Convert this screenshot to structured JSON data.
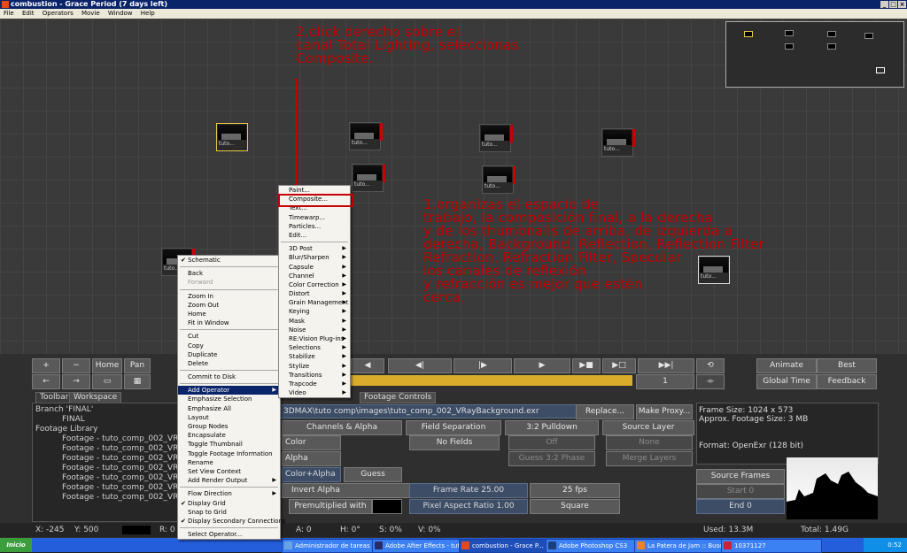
{
  "window": {
    "title": "combustion - Grace Period (7 days left)"
  },
  "menubar": [
    "File",
    "Edit",
    "Operators",
    "Movie",
    "Window",
    "Help"
  ],
  "schematic": {
    "nodes": [
      {
        "label": "tuto..."
      },
      {
        "label": "tuto..."
      },
      {
        "label": "tuto..."
      },
      {
        "label": "tuto..."
      },
      {
        "label": "tuto..."
      },
      {
        "label": "tuto..."
      },
      {
        "label": "tuto..."
      },
      {
        "label": "tuto..."
      }
    ],
    "annotation_top": "2.click derecho sobre el\ncanal Total Lighting, seleccionas\nComposite.",
    "annotation_main": "1.organizas el espacio de\ntrabajo, la composición final, a la derecha\ny de los thumbnails de arriba, de izquierda a\nderecha, Background, Reflection, Reflection Filter\nRefraction, Refraction Filter, Specular\nlos canales de reflexión\ny refracción es mejor que estén\ncerca."
  },
  "context_menu": {
    "items": [
      {
        "label": "Schematic",
        "checked": true
      },
      {
        "sep": true
      },
      {
        "label": "Back"
      },
      {
        "label": "Forward",
        "disabled": true
      },
      {
        "sep": true
      },
      {
        "label": "Zoom In"
      },
      {
        "label": "Zoom Out"
      },
      {
        "label": "Home"
      },
      {
        "label": "Fit in Window"
      },
      {
        "sep": true
      },
      {
        "label": "Cut"
      },
      {
        "label": "Copy"
      },
      {
        "label": "Duplicate"
      },
      {
        "label": "Delete"
      },
      {
        "sep": true
      },
      {
        "label": "Commit to Disk"
      },
      {
        "sep": true
      },
      {
        "label": "Add Operator",
        "submenu": true,
        "highlighted": true
      },
      {
        "label": "Emphasize Selection"
      },
      {
        "label": "Emphasize All"
      },
      {
        "label": "Layout"
      },
      {
        "label": "Group Nodes"
      },
      {
        "label": "Encapsulate"
      },
      {
        "label": "Toggle Thumbnail"
      },
      {
        "label": "Toggle Footage Information"
      },
      {
        "label": "Rename"
      },
      {
        "label": "Set View Context"
      },
      {
        "label": "Add Render Output",
        "submenu": true
      },
      {
        "sep": true
      },
      {
        "label": "Flow Direction",
        "submenu": true
      },
      {
        "label": "Display Grid",
        "checked": true
      },
      {
        "label": "Snap to Grid"
      },
      {
        "label": "Display Secondary Connections",
        "checked": true
      },
      {
        "sep": true
      },
      {
        "label": "Select Operator..."
      }
    ]
  },
  "submenu": {
    "items": [
      {
        "label": "Paint..."
      },
      {
        "label": "Composite..."
      },
      {
        "label": "Text..."
      },
      {
        "label": "Timewarp..."
      },
      {
        "label": "Particles..."
      },
      {
        "label": "Edit..."
      },
      {
        "sep": true
      },
      {
        "label": "3D Post",
        "submenu": true
      },
      {
        "label": "Blur/Sharpen",
        "submenu": true
      },
      {
        "label": "Capsule",
        "submenu": true
      },
      {
        "label": "Channel",
        "submenu": true
      },
      {
        "label": "Color Correction",
        "submenu": true
      },
      {
        "label": "Distort",
        "submenu": true
      },
      {
        "label": "Grain Management",
        "submenu": true
      },
      {
        "label": "Keying",
        "submenu": true
      },
      {
        "label": "Mask",
        "submenu": true
      },
      {
        "label": "Noise",
        "submenu": true
      },
      {
        "label": "RE:Vision Plug-ins",
        "submenu": true
      },
      {
        "label": "Selections",
        "submenu": true
      },
      {
        "label": "Stabilize",
        "submenu": true
      },
      {
        "label": "Stylize",
        "submenu": true
      },
      {
        "label": "Transitions",
        "submenu": true
      },
      {
        "label": "Trapcode",
        "submenu": true
      },
      {
        "label": "Video",
        "submenu": true
      }
    ]
  },
  "transport": {
    "left": [
      "+",
      "−",
      "Home",
      "Pan"
    ],
    "frame": "1",
    "animate": "Animate",
    "best": "Best",
    "global_time": "Global Time",
    "feedback": "Feedback"
  },
  "panel_tabs": [
    "Toolbar",
    "Workspace",
    "Footage Controls"
  ],
  "workspace_tree": {
    "branch": "Branch 'FINAL'",
    "final": "FINAL",
    "library": "Footage Library",
    "items": [
      "Footage - tuto_comp_002_VRay",
      "Footage - tuto_comp_002_VRay",
      "Footage - tuto_comp_002_VRay",
      "Footage - tuto_comp_002_VRay",
      "Footage - tuto_comp_002_VRay",
      "Footage - tuto_comp_002_VRay",
      "Footage - tuto_comp_002_VRay"
    ]
  },
  "footage_controls": {
    "path": "3DMAX\\tuto comp\\images\\tuto_comp_002_VRayBackground.exr",
    "replace": "Replace...",
    "make_proxy": "Make Proxy...",
    "channels_alpha": "Channels & Alpha",
    "field_separation": "Field Separation",
    "pulldown": "3:2 Pulldown",
    "source_layer": "Source Layer",
    "color": "Color",
    "no_fields": "No Fields",
    "off": "Off",
    "none": "None",
    "alpha": "Alpha",
    "guess_32": "Guess 3:2 Phase",
    "merge_layers": "Merge Layers",
    "color_alpha": "Color+Alpha",
    "guess": "Guess",
    "invert_alpha": "Invert Alpha",
    "frame_rate": "Frame Rate 25.00",
    "fps": "25 fps",
    "premultiplied": "Premultiplied with",
    "par": "Pixel Aspect Ratio 1.00",
    "square": "Square"
  },
  "info": {
    "frame_size": "Frame Size: 1024 x 573",
    "approx": "Approx. Footage Size:   3 MB",
    "format": "Format: OpenExr (128 bit)",
    "source_frames": "Source Frames",
    "start": "Start 0",
    "end": "End 0"
  },
  "statusbar": {
    "x": "X: -245",
    "y": "Y: 500",
    "r": "R: 0",
    "a": "A: 0",
    "h": "H: 0°",
    "s": "S: 0%",
    "v": "V: 0%",
    "used": "Used: 13.3M",
    "total": "Total: 1.49G"
  },
  "taskbar": {
    "start": "Inicio",
    "tasks": [
      "Administrador de tareas ...",
      "Adobe After Effects - tut...",
      "combustion - Grace P...",
      "Adobe Photoshop CS3",
      "La Patera de Jam :: Busc...",
      "10371127"
    ],
    "clock": "0:52"
  },
  "colors": {
    "annotation": "#c40000",
    "timeline": "#d9ac2b",
    "highlight": "#0a246a"
  }
}
